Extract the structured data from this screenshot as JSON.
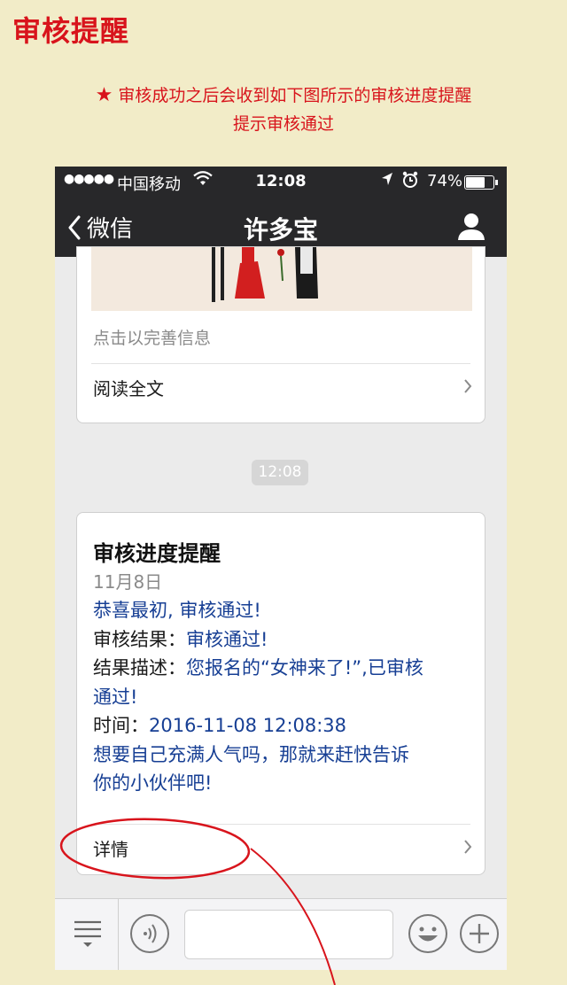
{
  "heading": "审核提醒",
  "notice": {
    "line1": "审核成功之后会收到如下图所示的审核进度提醒",
    "line2": "提示审核通过"
  },
  "status_bar": {
    "signal": "●●●●●",
    "carrier": "中国移动",
    "time": "12:08",
    "battery_text": "74%",
    "battery_level": 0.74
  },
  "nav": {
    "back_label": "微信",
    "title": "许多宝"
  },
  "article_card": {
    "hint": "点击以完善信息",
    "read_more": "阅读全文"
  },
  "time_badge": "12:08",
  "notification_card": {
    "title": "审核进度提醒",
    "date": "11月8日",
    "greeting": "恭喜最初, 审核通过!",
    "result_label": "审核结果：",
    "result_value": "审核通过!",
    "desc_label": "结果描述：",
    "desc_value_line1": "您报名的“女神来了!”,已审核",
    "desc_value_line2": "通过!",
    "time_label": "时间：",
    "time_value": "2016-11-08 12:08:38",
    "closing_line1": "想要自己充满人气吗，那就来赶快告诉",
    "closing_line2": "你的小伙伴吧!",
    "details": "详情"
  },
  "colors": {
    "background": "#f2ecc8",
    "accent_red": "#d8141c",
    "wechat_dark": "#28282a",
    "template_blue": "#173f94"
  },
  "icons": [
    "star-icon",
    "wifi-icon",
    "location-arrow-icon",
    "alarm-icon",
    "battery-icon",
    "chevron-left-icon",
    "profile-icon",
    "chevron-right-icon",
    "menu-list-icon",
    "voice-icon",
    "emoji-icon",
    "plus-icon"
  ]
}
